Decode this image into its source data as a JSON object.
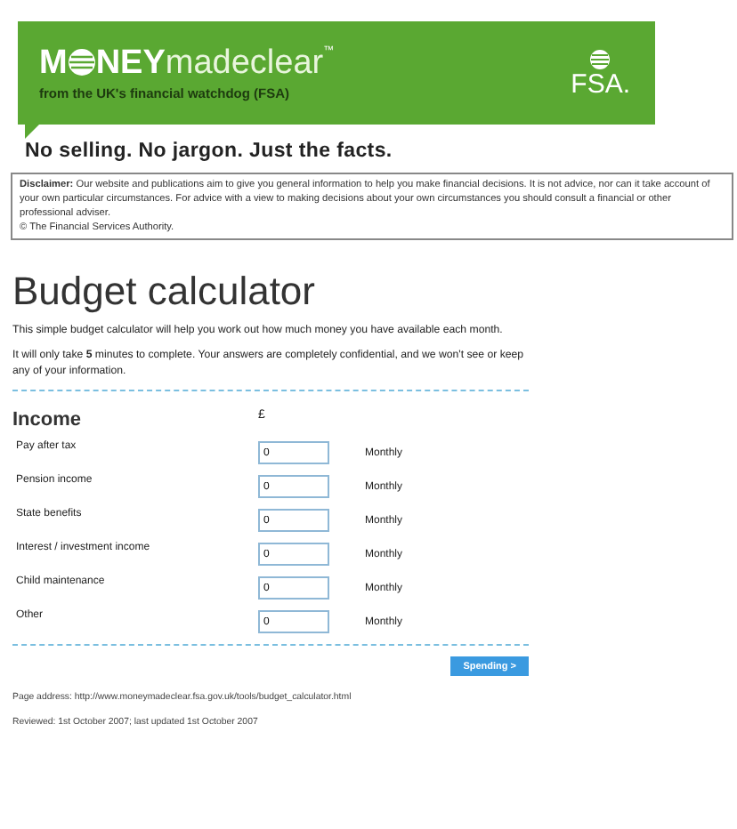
{
  "banner": {
    "logo_start": "M",
    "logo_end": "NEY",
    "logo_light": "madeclear",
    "trademark": "™",
    "subtitle": "from the UK's financial watchdog (FSA)",
    "fsa_logo": "FSA."
  },
  "tagline": "No selling. No jargon. Just the facts.",
  "disclaimer": {
    "text": "**Disclaimer:** Our website and publications aim to give you general information to help you make financial decisions. It is not advice, nor can it take account of your own particular circumstances. For advice with a view to making decisions about your own circumstances you should consult a financial or other professional adviser.",
    "copyright": "© The Financial Services Authority."
  },
  "title": "Budget calculator",
  "intro": [
    "This simple budget calculator will help you work out how much money you have available each month.",
    "It will only take **5** minutes to complete. Your answers are completely confidential, and we won't see or keep any of your information."
  ],
  "section": {
    "heading": "Income",
    "currency": "£",
    "rows": [
      {
        "label": "Pay after tax",
        "value": "0",
        "period": "Monthly"
      },
      {
        "label": "Pension income",
        "value": "0",
        "period": "Monthly"
      },
      {
        "label": "State benefits",
        "value": "0",
        "period": "Monthly"
      },
      {
        "label": "Interest / investment income",
        "value": "0",
        "period": "Monthly"
      },
      {
        "label": "Child maintenance",
        "value": "0",
        "period": "Monthly"
      },
      {
        "label": "Other",
        "value": "0",
        "period": "Monthly"
      }
    ]
  },
  "next_button": "Spending >",
  "footer": {
    "address_label": "Page address:",
    "address_link": "http://www.moneymadeclear.fsa.gov.uk/tools/budget_calculator.html",
    "reviewed": "Reviewed: 1st October 2007; last updated 1st October 2007"
  }
}
